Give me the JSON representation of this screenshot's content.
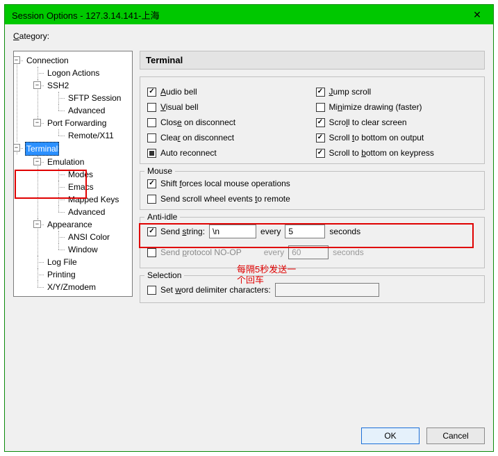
{
  "window": {
    "title": "Session Options - 127.3.14.141-上海",
    "close_glyph": "✕"
  },
  "category_label": "Category:",
  "tree": {
    "connection": "Connection",
    "logon_actions": "Logon Actions",
    "ssh2": "SSH2",
    "sftp_session": "SFTP Session",
    "ssh_advanced": "Advanced",
    "port_forwarding": "Port Forwarding",
    "remote_x11": "Remote/X11",
    "terminal": "Terminal",
    "emulation": "Emulation",
    "modes": "Modes",
    "emacs": "Emacs",
    "mapped_keys": "Mapped Keys",
    "em_advanced": "Advanced",
    "appearance": "Appearance",
    "ansi_color": "ANSI Color",
    "window": "Window",
    "log_file": "Log File",
    "printing": "Printing",
    "xyz": "X/Y/Zmodem"
  },
  "panel_header": "Terminal",
  "checkboxes": {
    "audio_bell": "Audio bell",
    "visual_bell": "Visual bell",
    "close_disconnect": "Close on disconnect",
    "clear_disconnect": "Clear on disconnect",
    "auto_reconnect": "Auto reconnect",
    "jump_scroll": "Jump scroll",
    "min_drawing": "Minimize drawing (faster)",
    "scroll_clear": "Scroll to clear screen",
    "scroll_bottom_output": "Scroll to bottom on output",
    "scroll_bottom_keypress": "Scroll to bottom on keypress"
  },
  "mouse": {
    "legend": "Mouse",
    "shift_local": "Shift forces local mouse operations",
    "send_scroll": "Send scroll wheel events to remote"
  },
  "antiidle": {
    "legend": "Anti-idle",
    "send_string_label": "Send string:",
    "send_string_value": "\\n",
    "every": "every",
    "seconds": "seconds",
    "interval_value": "5",
    "noop_label": "Send protocol NO-OP",
    "noop_interval": "60"
  },
  "selection": {
    "legend": "Selection",
    "word_delim": "Set word delimiter characters:"
  },
  "annotation": "每隔5秒发送一\n个回车",
  "buttons": {
    "ok": "OK",
    "cancel": "Cancel"
  }
}
